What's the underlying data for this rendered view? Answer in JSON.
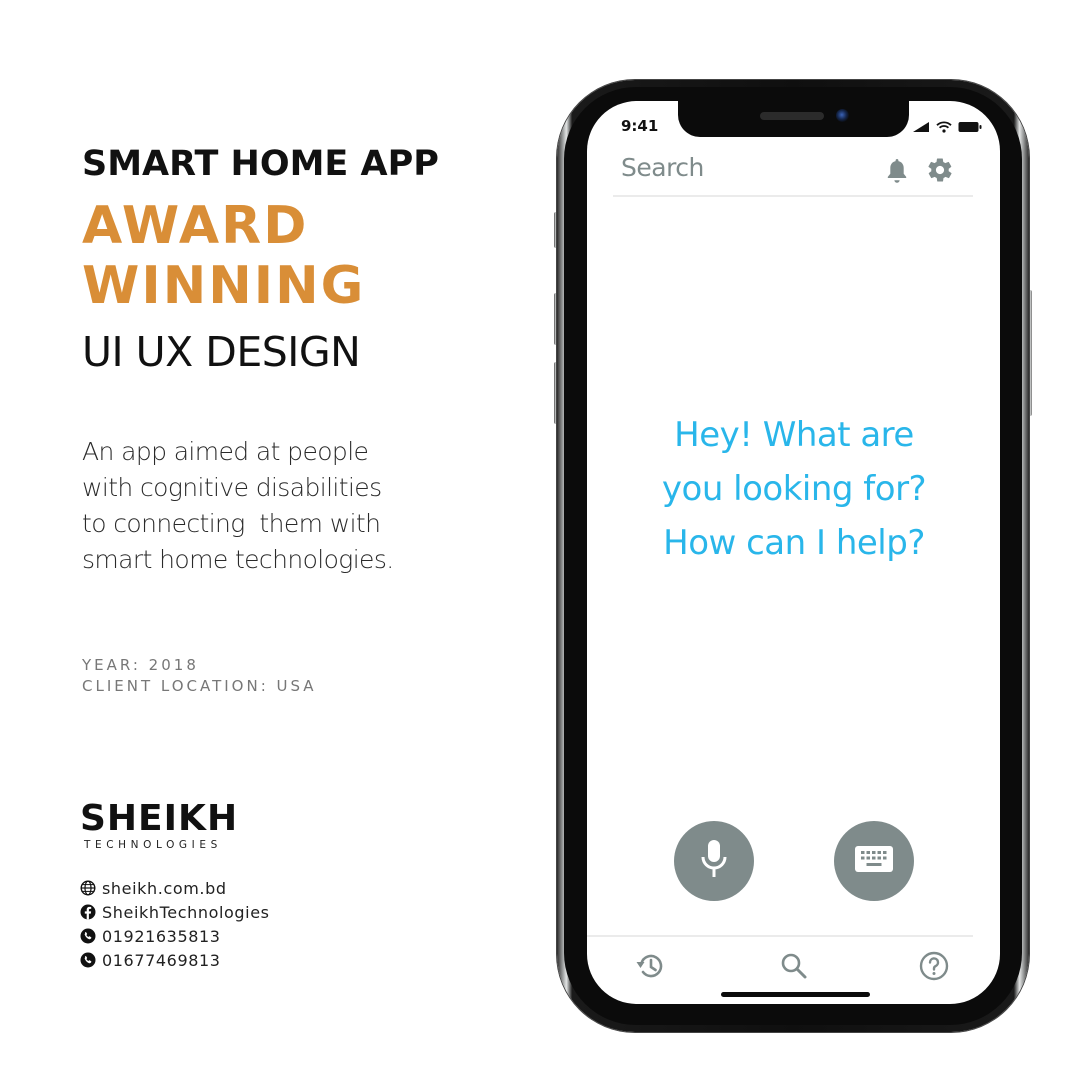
{
  "headline": {
    "line1": "SMART HOME APP",
    "line2": "AWARD",
    "line3": "WINNING",
    "line4": "UI UX DESIGN"
  },
  "description": [
    "An app aimed at people",
    "with cognitive disabilities",
    "to connecting  them with",
    "smart home technologies."
  ],
  "meta": {
    "year": "YEAR: 2018",
    "client_location": "CLIENT LOCATION: USA"
  },
  "brand": {
    "name": "SHEIKH",
    "tagline": "TECHNOLOGIES"
  },
  "contacts": [
    {
      "icon": "globe-icon",
      "text": "sheikh.com.bd"
    },
    {
      "icon": "facebook-icon",
      "text": "SheikhTechnologies"
    },
    {
      "icon": "phone-icon",
      "text": "01921635813"
    },
    {
      "icon": "phone-icon",
      "text": "01677469813"
    }
  ],
  "phone": {
    "status_bar": {
      "time": "9:41",
      "icons": [
        "signal-icon",
        "wifi-icon",
        "battery-icon"
      ]
    },
    "header": {
      "search_label": "Search",
      "icons": [
        "bell-icon",
        "gear-icon"
      ]
    },
    "prompt": [
      "Hey! What are",
      "you looking for?",
      "How can I help?"
    ],
    "actions": [
      "microphone-icon",
      "keyboard-icon"
    ],
    "bottom_nav": [
      "history-icon",
      "search-icon",
      "help-icon"
    ]
  },
  "colors": {
    "accent": "#d98e37",
    "prompt_text": "#29b6ea",
    "ui_gray": "#7f8b8b",
    "headline_dark": "#111111"
  }
}
